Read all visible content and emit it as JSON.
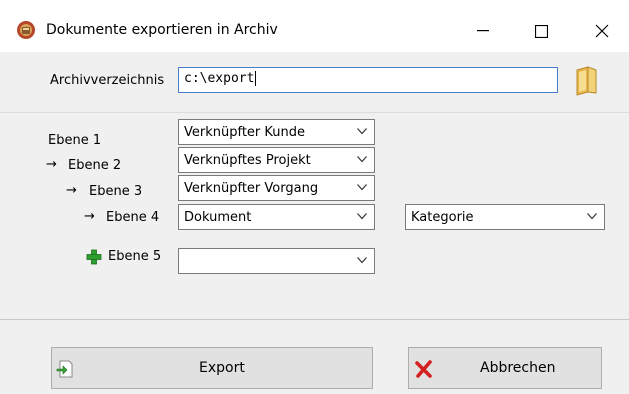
{
  "window": {
    "title": "Dokumente exportieren in Archiv",
    "controls": [
      "minimize-icon",
      "maximize-icon",
      "close-icon"
    ]
  },
  "archive": {
    "label": "Archivverzeichnis",
    "value": "c:\\export"
  },
  "levels": [
    {
      "label": "Ebene 1",
      "arrow": "",
      "combo": "Verknüpfter Kunde"
    },
    {
      "label": "Ebene 2",
      "arrow": "→",
      "combo": "Verknüpftes Projekt"
    },
    {
      "label": "Ebene 3",
      "arrow": "→",
      "combo": "Verknüpfter Vorgang"
    },
    {
      "label": "Ebene 4",
      "arrow": "→",
      "combo": "Dokument",
      "extra_combo": "Kategorie"
    },
    {
      "label": "Ebene 5",
      "icon": "plus-icon",
      "combo": ""
    }
  ],
  "buttons": {
    "export": "Export",
    "cancel": "Abbrechen"
  },
  "colors": {
    "accent_border": "#4a7fcf",
    "plus_green": "#2e9e2e",
    "cancel_red": "#d42020",
    "folder_yellow": "#e8b84a"
  }
}
